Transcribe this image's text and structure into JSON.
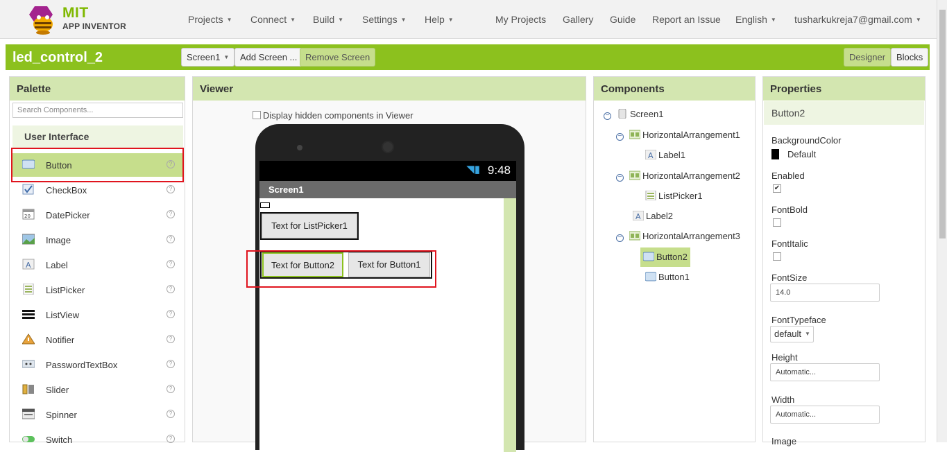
{
  "brand": {
    "mit": "MIT",
    "ai": "APP INVENTOR"
  },
  "nav": {
    "projects": "Projects",
    "connect": "Connect",
    "build": "Build",
    "settings": "Settings",
    "help": "Help",
    "my_projects": "My Projects",
    "gallery": "Gallery",
    "guide": "Guide",
    "report": "Report an Issue",
    "language": "English",
    "account": "tusharkukreja7@gmail.com"
  },
  "project": {
    "title": "led_control_2",
    "screen_select": "Screen1",
    "add_screen": "Add Screen ...",
    "remove_screen": "Remove Screen",
    "designer": "Designer",
    "blocks": "Blocks"
  },
  "palette": {
    "title": "Palette",
    "search_placeholder": "Search Components...",
    "category": "User Interface",
    "items": [
      {
        "label": "Button",
        "icon": "button-icon"
      },
      {
        "label": "CheckBox",
        "icon": "checkbox-icon"
      },
      {
        "label": "DatePicker",
        "icon": "datepicker-icon"
      },
      {
        "label": "Image",
        "icon": "image-icon"
      },
      {
        "label": "Label",
        "icon": "label-icon"
      },
      {
        "label": "ListPicker",
        "icon": "listpicker-icon"
      },
      {
        "label": "ListView",
        "icon": "listview-icon"
      },
      {
        "label": "Notifier",
        "icon": "notifier-icon"
      },
      {
        "label": "PasswordTextBox",
        "icon": "passwordtextbox-icon"
      },
      {
        "label": "Slider",
        "icon": "slider-icon"
      },
      {
        "label": "Spinner",
        "icon": "spinner-icon"
      },
      {
        "label": "Switch",
        "icon": "switch-icon"
      }
    ],
    "help_glyph": "?"
  },
  "viewer": {
    "title": "Viewer",
    "hidden_label": "Display hidden components in Viewer",
    "time": "9:48",
    "screen_title": "Screen1",
    "listpicker": "Text for ListPicker1",
    "button2": "Text for Button2",
    "button1": "Text for Button1"
  },
  "components": {
    "title": "Components",
    "tree": [
      "Screen1",
      "HorizontalArrangement1",
      "Label1",
      "HorizontalArrangement2",
      "ListPicker1",
      "Label2",
      "HorizontalArrangement3",
      "Button2",
      "Button1"
    ]
  },
  "properties": {
    "title": "Properties",
    "selected": "Button2",
    "background_color": "BackgroundColor",
    "background_value": "Default",
    "enabled": "Enabled",
    "fontbold": "FontBold",
    "fontitalic": "FontItalic",
    "fontsize": "FontSize",
    "fontsize_value": "14.0",
    "fonttypeface": "FontTypeface",
    "fonttypeface_value": "default",
    "height": "Height",
    "height_value": "Automatic...",
    "width": "Width",
    "width_value": "Automatic...",
    "image": "Image",
    "check_mark": "✔"
  },
  "colors": {
    "accent": "#8cc11e",
    "highlight": "#e0141e",
    "panel_head": "#d3e6b0"
  }
}
